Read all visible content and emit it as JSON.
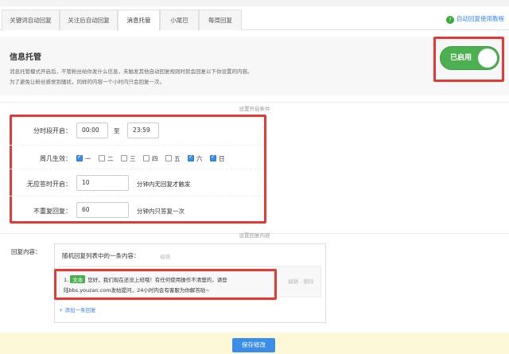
{
  "tabs": [
    {
      "label": "关键词自动回复"
    },
    {
      "label": "关注后自动回复"
    },
    {
      "label": "消息托管"
    },
    {
      "label": "小尾巴"
    },
    {
      "label": "每周回复"
    }
  ],
  "help_link": "自动回复使用教程",
  "info": {
    "title": "信息托管",
    "desc_line1": "消息托管模式开启后，不管粉丝给你发什么信息，未触发其他自动回复规则时就会回复以下你设置的内容。",
    "desc_line2": "为了避免让粉丝感觉到骚扰，同样的内容一个小时内只会回复一次。",
    "toggle_label": "已启用"
  },
  "conditions": {
    "section_title": "设置开启条件",
    "time_label": "分时段开启：",
    "time_start": "00:00",
    "time_sep": "至",
    "time_end": "23:59",
    "weekday_label": "周几生效：",
    "days": [
      {
        "label": "一",
        "checked": true
      },
      {
        "label": "二",
        "checked": false
      },
      {
        "label": "三",
        "checked": false
      },
      {
        "label": "四",
        "checked": false
      },
      {
        "label": "五",
        "checked": false
      },
      {
        "label": "六",
        "checked": true
      },
      {
        "label": "日",
        "checked": true
      }
    ],
    "noanswer_label": "无应答时开启：",
    "noanswer_value": "10",
    "noanswer_suffix": "分钟内无回复才触发",
    "norepeat_label": "不重复回复：",
    "norepeat_value": "60",
    "norepeat_suffix": "分钟内只答复一次"
  },
  "reply": {
    "section_title": "设置回复内容",
    "label": "回复内容：",
    "mode_text": "随机回复列表中的一条内容：",
    "edit_top": "编辑",
    "item_index": "1.",
    "item_tag": "文本",
    "item_line1": "您好，我们现在还没上班哦！有任何使用操作不清楚的，请登",
    "item_line2": "陆bbs.youzan.com发帖提问，24小时内会有客服为你解答哒~",
    "item_actions": "编辑 - 删除",
    "add_link": "+ 添加一条回复"
  },
  "footer": {
    "save_label": "保存修改"
  }
}
